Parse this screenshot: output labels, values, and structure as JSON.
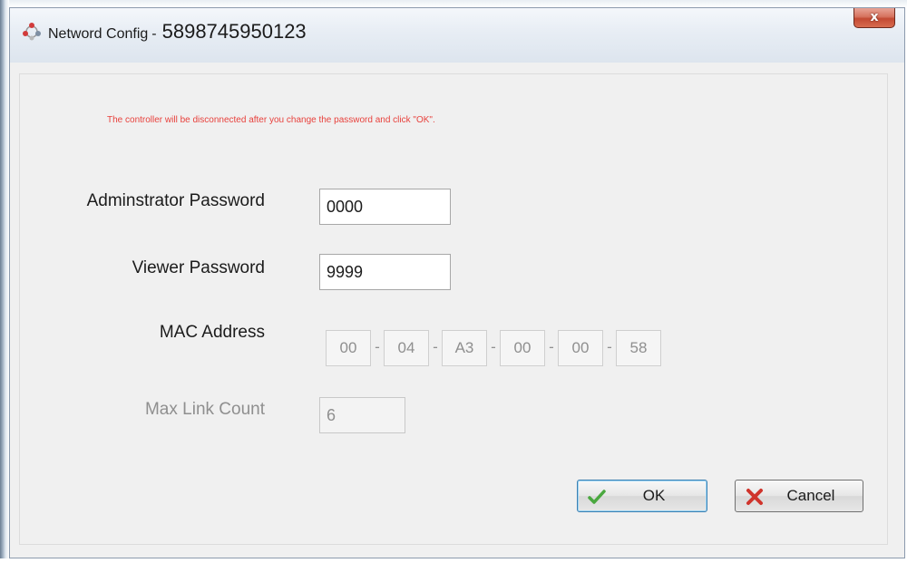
{
  "window": {
    "title_prefix": "Netword Config",
    "title_separator": "-",
    "title_id": "5898745950123",
    "close_label": "x"
  },
  "warning": "The controller will be disconnected after you change the password and click \"OK\".",
  "fields": {
    "admin_password": {
      "label": "Adminstrator Password",
      "value": "0000"
    },
    "viewer_password": {
      "label": "Viewer Password",
      "value": "9999"
    },
    "mac_address": {
      "label": "MAC Address",
      "octets": [
        "00",
        "04",
        "A3",
        "00",
        "00",
        "58"
      ],
      "separator": "-"
    },
    "max_link_count": {
      "label": "Max Link Count",
      "value": "6"
    }
  },
  "buttons": {
    "ok": {
      "label": "OK",
      "icon": "checkmark-icon"
    },
    "cancel": {
      "label": "Cancel",
      "icon": "cross-icon"
    }
  },
  "colors": {
    "warning": "#e8413c",
    "disabled_text": "#8f8f8f",
    "ok_border": "#3c7fb1"
  }
}
